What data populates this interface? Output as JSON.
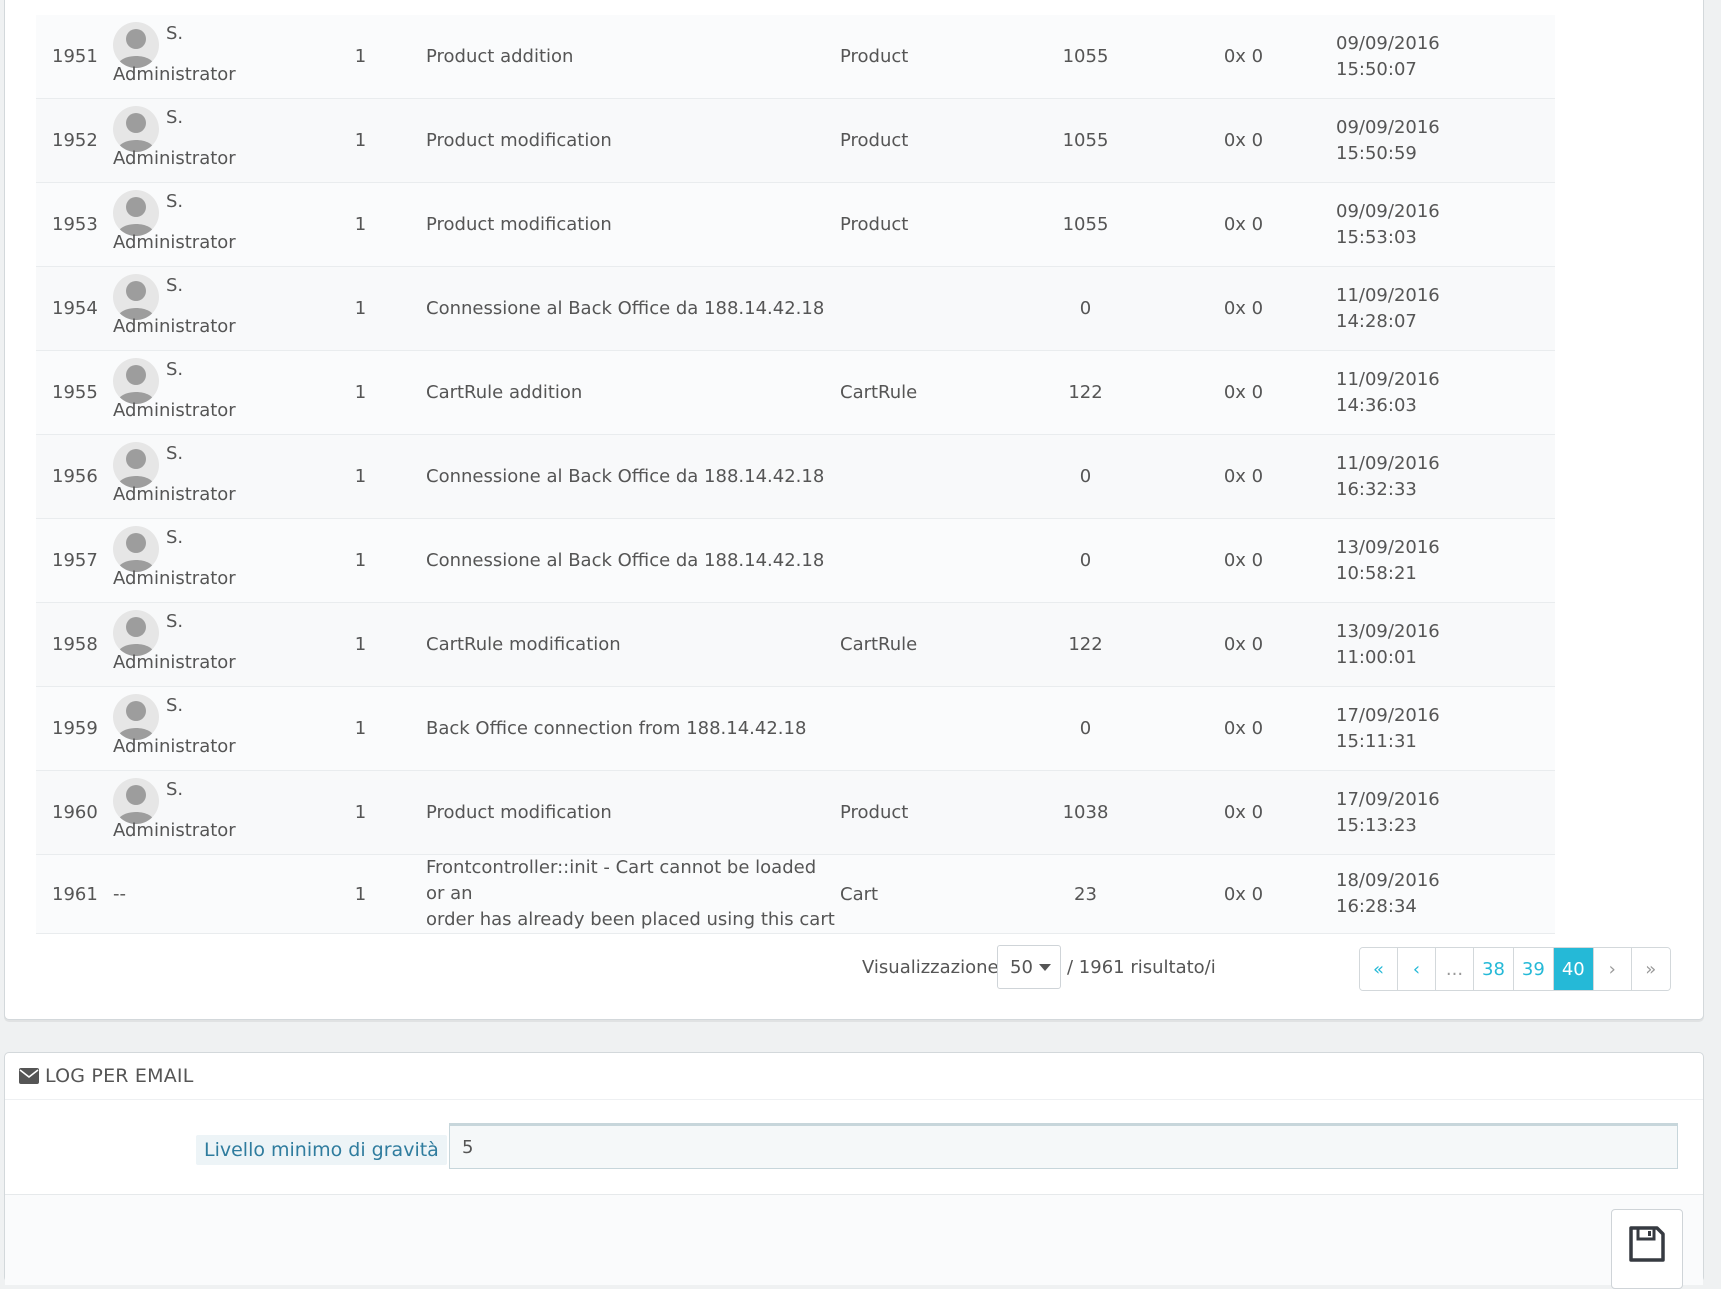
{
  "log_rows": [
    {
      "id": "1951",
      "employee_first": "S.",
      "employee_last": "Administrator",
      "severity": "1",
      "message_lines": [
        "Product addition"
      ],
      "object_type": "Product",
      "object_id": "1055",
      "error_code": "0x 0",
      "date": "09/09/2016",
      "time": "15:50:07"
    },
    {
      "id": "1952",
      "employee_first": "S.",
      "employee_last": "Administrator",
      "severity": "1",
      "message_lines": [
        "Product modification"
      ],
      "object_type": "Product",
      "object_id": "1055",
      "error_code": "0x 0",
      "date": "09/09/2016",
      "time": "15:50:59"
    },
    {
      "id": "1953",
      "employee_first": "S.",
      "employee_last": "Administrator",
      "severity": "1",
      "message_lines": [
        "Product modification"
      ],
      "object_type": "Product",
      "object_id": "1055",
      "error_code": "0x 0",
      "date": "09/09/2016",
      "time": "15:53:03"
    },
    {
      "id": "1954",
      "employee_first": "S.",
      "employee_last": "Administrator",
      "severity": "1",
      "message_lines": [
        "Connessione al Back Office da 188.14.42.18"
      ],
      "object_type": "",
      "object_id": "0",
      "error_code": "0x 0",
      "date": "11/09/2016",
      "time": "14:28:07"
    },
    {
      "id": "1955",
      "employee_first": "S.",
      "employee_last": "Administrator",
      "severity": "1",
      "message_lines": [
        "CartRule addition"
      ],
      "object_type": "CartRule",
      "object_id": "122",
      "error_code": "0x 0",
      "date": "11/09/2016",
      "time": "14:36:03"
    },
    {
      "id": "1956",
      "employee_first": "S.",
      "employee_last": "Administrator",
      "severity": "1",
      "message_lines": [
        "Connessione al Back Office da 188.14.42.18"
      ],
      "object_type": "",
      "object_id": "0",
      "error_code": "0x 0",
      "date": "11/09/2016",
      "time": "16:32:33"
    },
    {
      "id": "1957",
      "employee_first": "S.",
      "employee_last": "Administrator",
      "severity": "1",
      "message_lines": [
        "Connessione al Back Office da 188.14.42.18"
      ],
      "object_type": "",
      "object_id": "0",
      "error_code": "0x 0",
      "date": "13/09/2016",
      "time": "10:58:21"
    },
    {
      "id": "1958",
      "employee_first": "S.",
      "employee_last": "Administrator",
      "severity": "1",
      "message_lines": [
        "CartRule modification"
      ],
      "object_type": "CartRule",
      "object_id": "122",
      "error_code": "0x 0",
      "date": "13/09/2016",
      "time": "11:00:01"
    },
    {
      "id": "1959",
      "employee_first": "S.",
      "employee_last": "Administrator",
      "severity": "1",
      "message_lines": [
        "Back Office connection from 188.14.42.18"
      ],
      "object_type": "",
      "object_id": "0",
      "error_code": "0x 0",
      "date": "17/09/2016",
      "time": "15:11:31"
    },
    {
      "id": "1960",
      "employee_first": "S.",
      "employee_last": "Administrator",
      "severity": "1",
      "message_lines": [
        "Product modification"
      ],
      "object_type": "Product",
      "object_id": "1038",
      "error_code": "0x 0",
      "date": "17/09/2016",
      "time": "15:13:23"
    },
    {
      "id": "1961",
      "employee_none": "--",
      "severity": "1",
      "message_lines": [
        "Frontcontroller::init - Cart cannot be loaded or an",
        "order has already been placed using this cart"
      ],
      "object_type": "Cart",
      "object_id": "23",
      "error_code": "0x 0",
      "date": "18/09/2016",
      "time": "16:28:34"
    }
  ],
  "pagination": {
    "display_label": "Visualizzazione",
    "per_page": "50",
    "total_text": "/ 1961 risultato/i",
    "pages": [
      {
        "label": "«",
        "icon": "double-chevron-left-icon",
        "name": "page-first-button"
      },
      {
        "label": "‹",
        "icon": "chevron-left-icon",
        "name": "page-prev-button"
      },
      {
        "label": "...",
        "name": "page-ellipsis",
        "ellipsis": true
      },
      {
        "label": "38",
        "name": "page-38-button"
      },
      {
        "label": "39",
        "name": "page-39-button"
      },
      {
        "label": "40",
        "name": "page-40-button",
        "active": true
      },
      {
        "label": "›",
        "icon": "chevron-right-icon",
        "name": "page-next-button",
        "muted": true
      },
      {
        "label": "»",
        "icon": "double-chevron-right-icon",
        "name": "page-last-button",
        "muted": true
      }
    ]
  },
  "email_panel": {
    "title": "LOG PER EMAIL",
    "icon": "envelope-icon",
    "field_label": "Livello minimo di gravità",
    "field_value": "5",
    "save_icon": "floppy-disk-icon"
  },
  "colors": {
    "accent": "#25b9d7",
    "label_text": "#2f7c9e",
    "label_bg": "#edf4f7"
  }
}
